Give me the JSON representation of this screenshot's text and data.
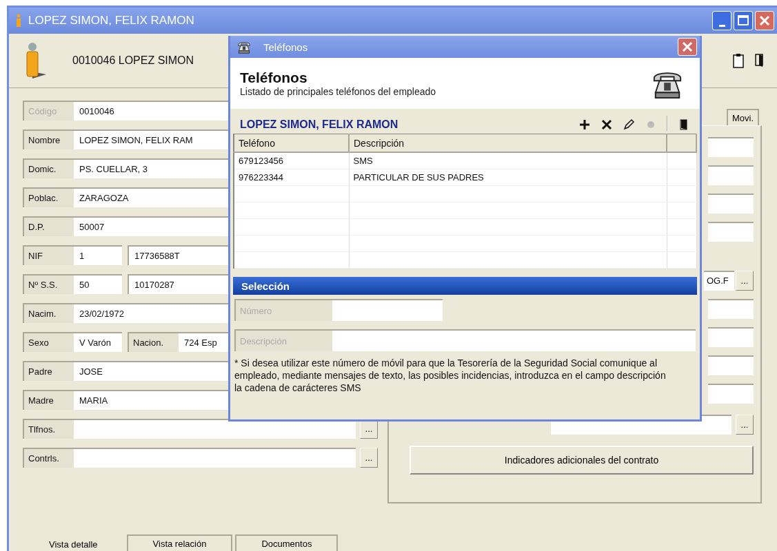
{
  "window": {
    "title": "LOPEZ SIMON, FELIX RAMON",
    "header": "0010046 LOPEZ SIMON"
  },
  "fields": [
    {
      "parts": [
        {
          "label": "Código",
          "value": "0010046",
          "disabled": true
        }
      ]
    },
    {
      "parts": [
        {
          "label": "Nombre",
          "value": "LOPEZ SIMON, FELIX RAM",
          "disabled": false
        }
      ]
    },
    {
      "parts": [
        {
          "label": "Domic.",
          "value": "PS. CUELLAR, 3",
          "disabled": false
        }
      ]
    },
    {
      "parts": [
        {
          "label": "Poblac.",
          "value": "ZARAGOZA",
          "disabled": false
        }
      ]
    },
    {
      "parts": [
        {
          "label": "D.P.",
          "value": "50007",
          "disabled": false
        }
      ]
    },
    {
      "parts": [
        {
          "label": "NIF",
          "value": "1",
          "disabled": false
        },
        {
          "value": "17736588T"
        }
      ]
    },
    {
      "parts": [
        {
          "label": "Nº S.S.",
          "value": "50",
          "disabled": false
        },
        {
          "value": "10170287"
        }
      ]
    },
    {
      "parts": [
        {
          "label": "Nacim.",
          "value": "23/02/1972",
          "disabled": false
        }
      ]
    },
    {
      "parts": [
        {
          "label": "Sexo",
          "value": "V Varón",
          "disabled": false
        },
        {
          "label": "Nacion.",
          "value": "724 Esp",
          "disabled": false
        }
      ]
    },
    {
      "parts": [
        {
          "label": "Padre",
          "value": "JOSE",
          "disabled": false
        }
      ]
    },
    {
      "parts": [
        {
          "label": "Madre",
          "value": "MARIA",
          "disabled": false
        }
      ]
    },
    {
      "parts": [
        {
          "label": "Tlfnos.",
          "disabled": false
        }
      ],
      "button": "..."
    },
    {
      "parts": [
        {
          "label": "Contrls.",
          "disabled": false
        }
      ],
      "button": "..."
    }
  ],
  "bottom_tabs": [
    {
      "label": "Vista detalle",
      "selected": true
    },
    {
      "label": "Vista relación",
      "selected": false
    },
    {
      "label": "Documentos",
      "selected": false
    }
  ],
  "right_panel": {
    "tabs": [
      {
        "label": "Movi.",
        "selected": false
      }
    ],
    "lookup_value": "OG.F",
    "lookup_button": "...",
    "cese_button": "...",
    "contract_button": "Indicadores adicionales del contrato"
  },
  "dialog": {
    "title": "Teléfonos",
    "heading": "Teléfonos",
    "subtitle": "Listado de principales teléfonos del empleado",
    "employee": "LOPEZ SIMON, FELIX RAMON",
    "toolbar": [
      {
        "kind": "add",
        "disabled": false
      },
      {
        "kind": "delete",
        "disabled": false
      },
      {
        "kind": "edit",
        "disabled": false
      },
      {
        "kind": "record",
        "disabled": true
      },
      {
        "kind": "exit",
        "disabled": false
      }
    ],
    "table": {
      "columns": [
        "Teléfono",
        "Descripción"
      ],
      "rows": [
        [
          "679123456",
          "SMS"
        ],
        [
          "976223344",
          "PARTICULAR DE SUS PADRES"
        ]
      ]
    },
    "selection": {
      "title": "Selección",
      "fields": [
        {
          "label": "Número",
          "disabled": true
        },
        {
          "label": "Descripción",
          "disabled": true
        }
      ]
    },
    "note": "* Si desea utilizar este número de móvil para que la Tesorería de la Seguridad Social comunique al empleado, mediante mensajes de texto, las posibles incidencias, introduzca en el campo descripción la cadena de carácteres SMS"
  }
}
